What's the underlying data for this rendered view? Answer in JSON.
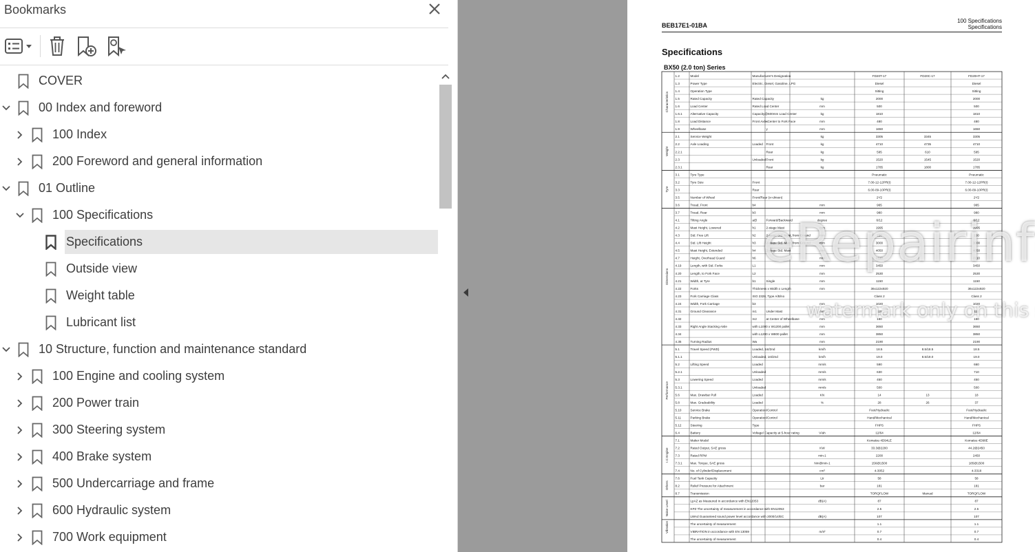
{
  "panel": {
    "title": "Bookmarks",
    "close_icon": "close-icon",
    "toolbar": [
      "options-menu-icon",
      "delete-bookmark-icon",
      "new-bookmark-icon",
      "find-bookmark-icon"
    ]
  },
  "bookmarks": [
    {
      "label": "COVER",
      "level": 0,
      "expander": "none"
    },
    {
      "label": "00 Index and foreword",
      "level": 0,
      "expander": "expanded"
    },
    {
      "label": "100 Index",
      "level": 1,
      "expander": "collapsed"
    },
    {
      "label": "200 Foreword and general information",
      "level": 1,
      "expander": "collapsed"
    },
    {
      "label": "01 Outline",
      "level": 0,
      "expander": "expanded"
    },
    {
      "label": "100 Specifications",
      "level": 1,
      "expander": "expanded"
    },
    {
      "label": "Specifications",
      "level": 2,
      "expander": "none",
      "selected": true
    },
    {
      "label": "Outside view",
      "level": 2,
      "expander": "none"
    },
    {
      "label": "Weight table",
      "level": 2,
      "expander": "none"
    },
    {
      "label": "Lubricant list",
      "level": 2,
      "expander": "none"
    },
    {
      "label": "10 Structure, function and maintenance standard",
      "level": 0,
      "expander": "expanded"
    },
    {
      "label": "100 Engine and cooling system",
      "level": 1,
      "expander": "collapsed"
    },
    {
      "label": "200 Power train",
      "level": 1,
      "expander": "collapsed"
    },
    {
      "label": "300 Steering system",
      "level": 1,
      "expander": "collapsed"
    },
    {
      "label": "400 Brake system",
      "level": 1,
      "expander": "collapsed"
    },
    {
      "label": "500 Undercarriage and frame",
      "level": 1,
      "expander": "collapsed"
    },
    {
      "label": "600 Hydraulic system",
      "level": 1,
      "expander": "collapsed"
    },
    {
      "label": "700 Work equipment",
      "level": 1,
      "expander": "collapsed"
    }
  ],
  "document": {
    "code": "BEB17E1-01BA",
    "section_line1": "100 Specifications",
    "section_line2": "Specifications",
    "title": "Specifications",
    "subtitle": "BX50 (2.0 ton) Series",
    "watermark_main": "eRepairinfo.com",
    "watermark_sub": "watermark only on this sample",
    "model_columns": [
      "FD20T-17",
      "FD20C-17",
      "FD20HT-17"
    ],
    "groups": [
      {
        "name": "Characteristics",
        "rows": 8
      },
      {
        "name": "Weight",
        "rows": 5
      },
      {
        "name": "Tyre",
        "rows": 5
      },
      {
        "name": "Dimensions",
        "rows": 18
      },
      {
        "name": "Performance",
        "rows": 12
      },
      {
        "name": "I.C Engine",
        "rows": 5
      },
      {
        "name": "Others",
        "rows": 3
      },
      {
        "name": "Noise Level",
        "rows": 3
      },
      {
        "name": "Vibration",
        "rows": 2
      }
    ],
    "rows": [
      [
        "1.2",
        "Model",
        "Manufacturer's Designation",
        "",
        "",
        "FD20T-17",
        "FD20C-17",
        "FD20HT-17"
      ],
      [
        "1.3",
        "Power Type",
        "Electric, Diesel, Gasoline, LPG",
        "",
        "",
        "Diesel",
        "",
        "Diesel"
      ],
      [
        "1.4",
        "Operation Type",
        "",
        "",
        "",
        "Sitting",
        "",
        "Sitting"
      ],
      [
        "1.5",
        "Rated Capacity",
        "Rated Capacity",
        "",
        "kg",
        "2000",
        "",
        "2000"
      ],
      [
        "1.6",
        "Load Center",
        "Rated Load Center",
        "",
        "mm",
        "500",
        "",
        "500"
      ],
      [
        "1.6.1",
        "Alternative Capacity",
        "Capacity@600mm Load Center",
        "",
        "kg",
        "1810",
        "",
        "1810"
      ],
      [
        "1.8",
        "Load Distance",
        "Front Axle Center to Fork Face",
        "x",
        "mm",
        "480",
        "",
        "480"
      ],
      [
        "1.9",
        "Wheelbase",
        "",
        "y",
        "mm",
        "1650",
        "",
        "1650"
      ],
      [
        "2.1",
        "Service Weight",
        "",
        "",
        "kg",
        "3305",
        "3345",
        "3305"
      ],
      [
        "2.2",
        "Axle Loading",
        "Loaded",
        "Front",
        "kg",
        "4710",
        "4735",
        "4710"
      ],
      [
        "2.2.1",
        "",
        "",
        "Rear",
        "kg",
        "595",
        "610",
        "595"
      ],
      [
        "2.3",
        "",
        "Unloaded",
        "Front",
        "kg",
        "1520",
        "1545",
        "1520"
      ],
      [
        "2.3.1",
        "",
        "",
        "Rear",
        "kg",
        "1785",
        "1800",
        "1785"
      ],
      [
        "3.1",
        "Tyre Type",
        "",
        "",
        "",
        "Pneumatic",
        "",
        "Pneumatic"
      ],
      [
        "3.2",
        "Tyre Size",
        "Front",
        "",
        "",
        "7.00-12-12PR(I)",
        "",
        "7.00-12-12PR(I)"
      ],
      [
        "3.3",
        "",
        "Rear",
        "",
        "",
        "6.00-09-10PR(I)",
        "",
        "6.00-09-10PR(I)"
      ],
      [
        "3.5",
        "Number of Wheel",
        "Front/Rear (x=driven)",
        "",
        "",
        "2*/2",
        "",
        "2*/2"
      ],
      [
        "3.6",
        "Tread, Front",
        "b4",
        "",
        "mm",
        "965",
        "",
        "965"
      ],
      [
        "3.7",
        "Tread, Rear",
        "b3",
        "",
        "mm",
        "980",
        "",
        "980"
      ],
      [
        "4.1",
        "Tilting Angle",
        "a/β",
        "Forward/Backward",
        "degree",
        "6/12",
        "",
        "6/12"
      ],
      [
        "4.2",
        "Mast Height, Lowered",
        "h1",
        "2-stage Mast",
        "mm",
        "1995",
        "",
        "1995"
      ],
      [
        "4.3",
        "Std. Free Lift",
        "h2",
        "2-stage Std. Mast, from Ground",
        "mm",
        "150",
        "",
        "150"
      ],
      [
        "4.4",
        "Std. Lift Height",
        "h3",
        "2-stage Std. Mast, from Ground",
        "mm",
        "3000",
        "",
        "3000"
      ],
      [
        "4.5",
        "Mast Height, Extended",
        "h4",
        "2-stage Std. Mast",
        "mm",
        "4050",
        "",
        "4050"
      ],
      [
        "4.7",
        "Height, Overhead Guard",
        "h6",
        "",
        "mm",
        "2110",
        "",
        "2110"
      ],
      [
        "4.19",
        "Length, with Std. Forks",
        "L1",
        "",
        "mm",
        "3450",
        "",
        "3450"
      ],
      [
        "4.20",
        "Length, to Fork Face",
        "L2",
        "",
        "mm",
        "2530",
        "",
        "2530"
      ],
      [
        "4.21",
        "Width, at Tyre",
        "b1",
        "Single",
        "mm",
        "1150",
        "",
        "1150"
      ],
      [
        "4.22",
        "Forks",
        "Thickness x Width x Length",
        "",
        "mm",
        "36x122x920",
        "",
        "36x122x920"
      ],
      [
        "4.23",
        "Fork Carriage Class",
        "ISO 2328, Type A/B/no",
        "",
        "",
        "Class 2",
        "",
        "Class 2"
      ],
      [
        "4.24",
        "Width, Fork Carriage",
        "b3",
        "",
        "mm",
        "1020",
        "",
        "1020"
      ],
      [
        "4.31",
        "Ground Clearance",
        "m1",
        "Under Mast",
        "mm",
        "115",
        "",
        "115"
      ],
      [
        "4.32",
        "",
        "m2",
        "at Center of Wheelbase",
        "mm",
        "160",
        "",
        "160"
      ],
      [
        "4.33",
        "Right Angle Stacking Aisle",
        "with L1000 x W1200 pallet",
        "",
        "mm",
        "3650",
        "",
        "3650"
      ],
      [
        "4.34",
        "",
        "with L1200 x W800 pallet",
        "",
        "mm",
        "3850",
        "",
        "3850"
      ],
      [
        "4.35",
        "Turning Radius",
        "Wa",
        "",
        "mm",
        "2190",
        "",
        "2190"
      ],
      [
        "5.1",
        "Travel Speed (FWD)",
        "Loaded, 1st/2nd",
        "",
        "km/h",
        "18.5",
        "8.5/18.5",
        "18.5"
      ],
      [
        "5.1.1",
        "",
        "Unloaded, 1st/2nd",
        "",
        "km/h",
        "19.0",
        "8.5/19.0",
        "19.0"
      ],
      [
        "5.2",
        "Lifting Speed",
        "Loaded",
        "",
        "mm/s",
        "590",
        "",
        "660"
      ],
      [
        "5.2.1",
        "",
        "Unloaded",
        "",
        "mm/s",
        "630",
        "",
        "710"
      ],
      [
        "5.3",
        "Lowering Speed",
        "Loaded",
        "",
        "mm/s",
        "450",
        "",
        "450"
      ],
      [
        "5.3.1",
        "",
        "Unloaded",
        "",
        "mm/s",
        "500",
        "",
        "500"
      ],
      [
        "5.6",
        "Max. Drawbar Pull",
        "Loaded",
        "",
        "KN",
        "14",
        "13",
        "18"
      ],
      [
        "5.8",
        "Max. Gradeability",
        "Loaded",
        "",
        "%",
        "28",
        "26",
        "37"
      ],
      [
        "5.10",
        "Service Brake",
        "Operation/Control",
        "",
        "",
        "Foot/Hydraulic",
        "",
        "Foot/Hydraulic"
      ],
      [
        "5.11",
        "Parking Brake",
        "Operation/Control",
        "",
        "",
        "Hand/Mechanical",
        "",
        "Hand/Mechanical"
      ],
      [
        "5.12",
        "Steering",
        "Type",
        "",
        "",
        "FHPS",
        "",
        "FHPS"
      ],
      [
        "6.4",
        "Battery",
        "Voltage/ Capacity at 5-hour rating",
        "",
        "V/ah",
        "12/64",
        "",
        "12/64"
      ],
      [
        "7.1",
        "Maker Model",
        "",
        "",
        "",
        "Komatsu 4D94LE",
        "",
        "Komatsu 4D98E"
      ],
      [
        "7.2",
        "Rated Output, SAE gross",
        "",
        "",
        "KW",
        "33.3@2200",
        "",
        "44.2@2450"
      ],
      [
        "7.3",
        "Rated RPM",
        "",
        "",
        "min-1",
        "2200",
        "",
        "2450"
      ],
      [
        "7.3.1",
        "Max. Torque, SAE gross",
        "",
        "",
        "Nm@min-1",
        "156@1500",
        "",
        "185@1500"
      ],
      [
        "7.4",
        "No. of Cylinder/Displacement",
        "",
        "",
        "cm³",
        "4-3052",
        "",
        "4-3318"
      ],
      [
        "7.6",
        "Fuel Tank Capacity",
        "",
        "",
        "Ltr",
        "58",
        "",
        "58"
      ],
      [
        "8.2",
        "Relief Pressure for Attachment",
        "",
        "",
        "bar",
        "181",
        "",
        "181"
      ],
      [
        "8.7",
        "Transmission",
        "",
        "",
        "",
        "TORQFLOW",
        "Manual",
        "TORQFLOW"
      ],
      [
        "",
        "LpAZ as Measured in accordance with EN12053",
        "",
        "",
        "dB(A)",
        "87",
        "",
        "87"
      ],
      [
        "",
        "KPZ The uncertainty of measurement in accordance with EN12053",
        "",
        "",
        "",
        "2.5",
        "",
        "2.5"
      ],
      [
        "",
        "LWAd Guaranteed sound power level accordance with 2000/14/EC",
        "",
        "",
        "dB(A)",
        "107",
        "",
        "107"
      ],
      [
        "",
        "The uncertainty of measurement",
        "",
        "",
        "",
        "1.1",
        "",
        "1.1"
      ],
      [
        "",
        "VIBRATION in accordance with EN 13059",
        "",
        "",
        "m/s²",
        "0.7",
        "",
        "0.7"
      ],
      [
        "",
        "The uncertainty of measurement",
        "",
        "",
        "",
        "0.4",
        "",
        "0.4"
      ]
    ]
  }
}
